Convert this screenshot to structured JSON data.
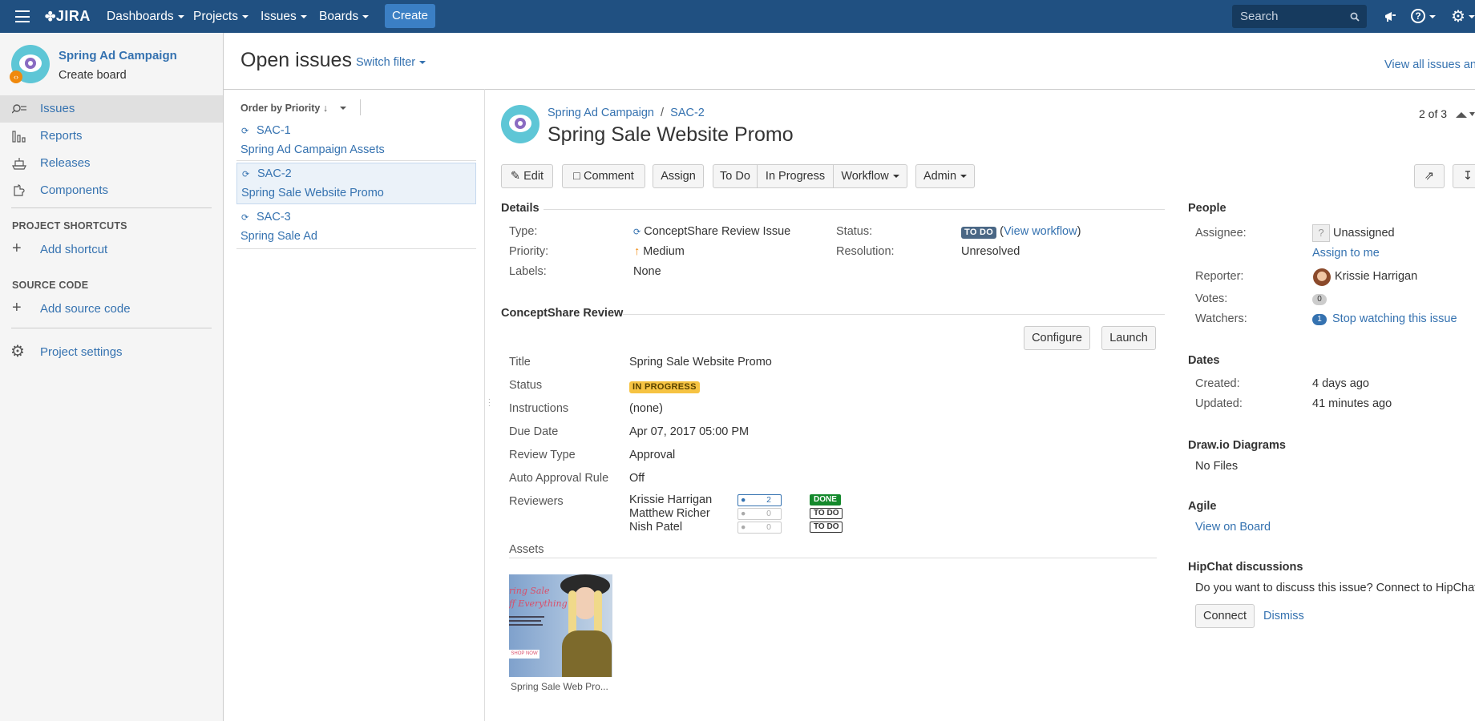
{
  "nav": {
    "logo": "JIRA",
    "menus": [
      "Dashboards",
      "Projects",
      "Issues",
      "Boards"
    ],
    "create": "Create",
    "search_placeholder": "Search"
  },
  "sidebar": {
    "project_name": "Spring Ad Campaign",
    "create_board": "Create board",
    "items": [
      {
        "label": "Issues",
        "icon": "issues-icon"
      },
      {
        "label": "Reports",
        "icon": "reports-icon"
      },
      {
        "label": "Releases",
        "icon": "releases-icon"
      },
      {
        "label": "Components",
        "icon": "components-icon"
      }
    ],
    "shortcuts_heading": "PROJECT SHORTCUTS",
    "add_shortcut": "Add shortcut",
    "source_heading": "SOURCE CODE",
    "add_source": "Add source code",
    "settings": "Project settings"
  },
  "header": {
    "title": "Open issues",
    "switch_filter": "Switch filter",
    "view_all": "View all issues an"
  },
  "issue_list": {
    "order_by": "Order by Priority",
    "issues": [
      {
        "key": "SAC-1",
        "summary": "Spring Ad Campaign Assets"
      },
      {
        "key": "SAC-2",
        "summary": "Spring Sale Website Promo"
      },
      {
        "key": "SAC-3",
        "summary": "Spring Sale Ad"
      }
    ]
  },
  "issue": {
    "breadcrumb_project": "Spring Ad Campaign",
    "breadcrumb_key": "SAC-2",
    "title": "Spring Sale Website Promo",
    "pager": "2 of 3",
    "buttons": {
      "edit": "Edit",
      "comment": "Comment",
      "assign": "Assign",
      "todo": "To Do",
      "inprogress": "In Progress",
      "workflow": "Workflow",
      "admin": "Admin"
    },
    "details": {
      "heading": "Details",
      "type_label": "Type:",
      "type_value": "ConceptShare Review Issue",
      "priority_label": "Priority:",
      "priority_value": "Medium",
      "labels_label": "Labels:",
      "labels_value": "None",
      "status_label": "Status:",
      "status_badge": "TO DO",
      "view_workflow": "View workflow",
      "resolution_label": "Resolution:",
      "resolution_value": "Unresolved"
    },
    "review": {
      "heading": "ConceptShare Review",
      "configure": "Configure",
      "launch": "Launch",
      "title_label": "Title",
      "title_value": "Spring Sale Website Promo",
      "status_label": "Status",
      "status_value": "IN PROGRESS",
      "instructions_label": "Instructions",
      "instructions_value": "(none)",
      "due_label": "Due Date",
      "due_value": "Apr 07, 2017 05:00 PM",
      "type_label": "Review Type",
      "type_value": "Approval",
      "auto_label": "Auto Approval Rule",
      "auto_value": "Off",
      "reviewers_label": "Reviewers",
      "reviewers": [
        {
          "name": "Krissie Harrigan",
          "comments": "2",
          "status": "DONE"
        },
        {
          "name": "Matthew Richer",
          "comments": "0",
          "status": "TO DO"
        },
        {
          "name": "Nish Patel",
          "comments": "0",
          "status": "TO DO"
        }
      ],
      "assets_label": "Assets",
      "asset_caption": "Spring Sale Web Pro...",
      "asset_art": {
        "line1": "ring Sale",
        "line2": "ff Everything",
        "button": "SHOP NOW"
      }
    }
  },
  "people": {
    "heading": "People",
    "assignee_label": "Assignee:",
    "assignee_value": "Unassigned",
    "assign_to_me": "Assign to me",
    "reporter_label": "Reporter:",
    "reporter_value": "Krissie Harrigan",
    "votes_label": "Votes:",
    "votes_value": "0",
    "watchers_label": "Watchers:",
    "watchers_count": "1",
    "stop_watching": "Stop watching this issue"
  },
  "dates": {
    "heading": "Dates",
    "created_label": "Created:",
    "created_value": "4 days ago",
    "updated_label": "Updated:",
    "updated_value": "41 minutes ago"
  },
  "drawio": {
    "heading": "Draw.io Diagrams",
    "value": "No Files"
  },
  "agile": {
    "heading": "Agile",
    "link": "View on Board"
  },
  "hipchat": {
    "heading": "HipChat discussions",
    "text": "Do you want to discuss this issue? Connect to HipChat.",
    "connect": "Connect",
    "dismiss": "Dismiss"
  }
}
